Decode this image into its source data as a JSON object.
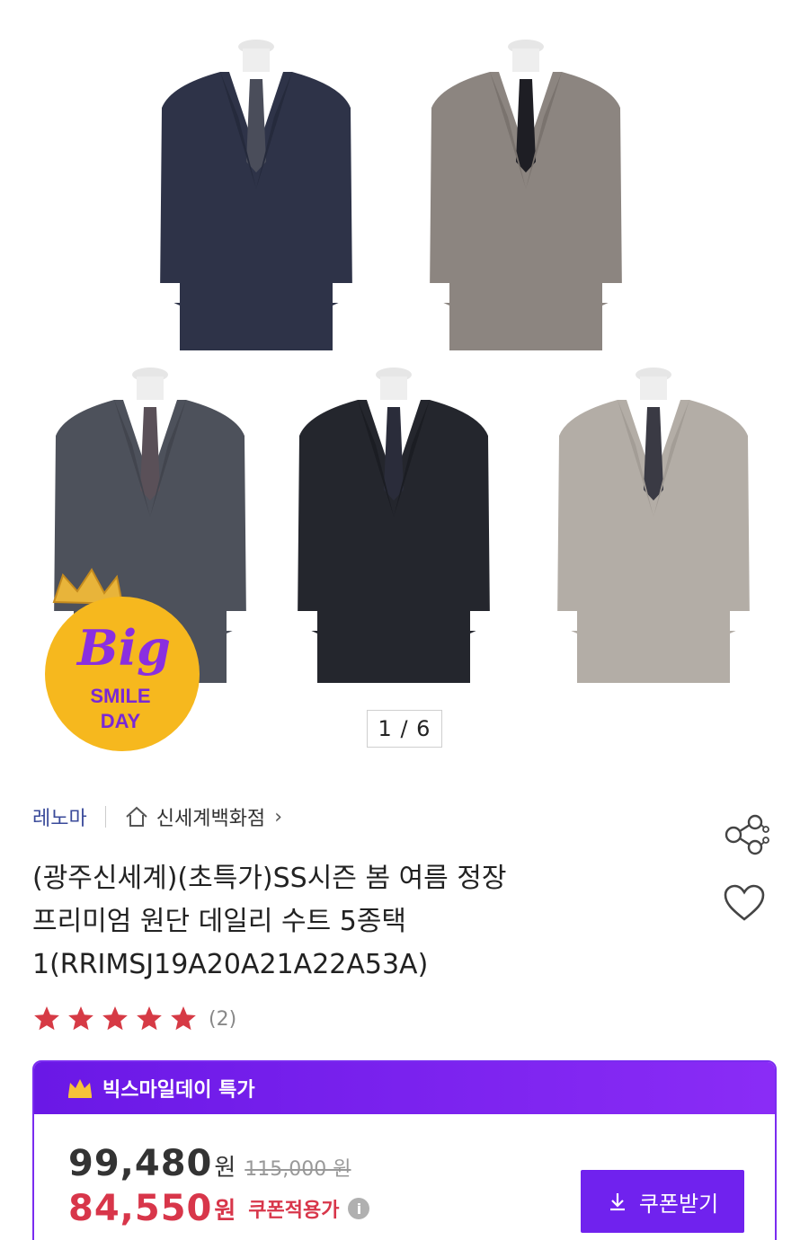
{
  "gallery": {
    "counter": "1 / 6",
    "suits": [
      {
        "name": "navy",
        "color": "#2e3348",
        "tie": "#4a4d5a"
      },
      {
        "name": "gray",
        "color": "#8c8580",
        "tie": "#1e1e24"
      },
      {
        "name": "charcoal",
        "color": "#4d515b",
        "tie": "#5a5058"
      },
      {
        "name": "black",
        "color": "#24262d",
        "tie": "#2a2c3a"
      },
      {
        "name": "light-gray",
        "color": "#b3ada6",
        "tie": "#3a3a44"
      }
    ],
    "badge": {
      "line1": "Big",
      "line2": "SMILE",
      "line3": "DAY"
    }
  },
  "seller": {
    "brand": "레노마",
    "store": "신세계백화점",
    "chevron": "›"
  },
  "product": {
    "title_line1": "(광주신세계)(초특가)SS시즌 봄 여름 정장",
    "title_line2": "프리미엄 원단 데일리 수트 5종택",
    "title_line3": "1(RRIMSJ19A20A21A22A53A)",
    "rating_count": "(2)",
    "stars": 5
  },
  "deal": {
    "header": "빅스마일데이 특가",
    "price": "99,480",
    "price_unit": "원",
    "original_price": "115,000 원",
    "coupon_price": "84,550",
    "coupon_unit": "원",
    "coupon_label": "쿠폰적용가",
    "coupon_button": "쿠폰받기"
  },
  "colors": {
    "accent_purple": "#7022ee",
    "sale_red": "#d8364a",
    "star_red": "#d63a45",
    "brand_blue": "#3a4a9a"
  }
}
